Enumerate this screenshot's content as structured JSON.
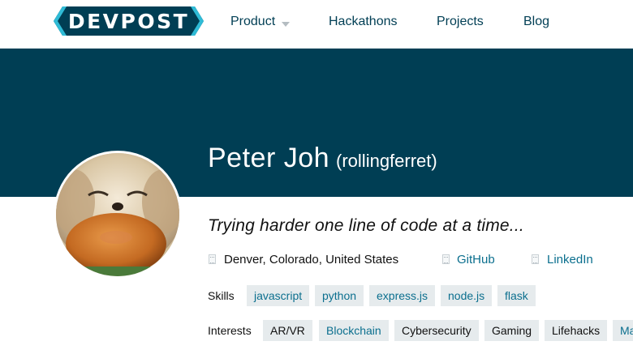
{
  "nav": {
    "logo_text": "DEVPOST",
    "items": [
      {
        "label": "Product"
      },
      {
        "label": "Hackathons"
      },
      {
        "label": "Projects"
      },
      {
        "label": "Blog"
      }
    ]
  },
  "profile": {
    "name": "Peter Joh",
    "username": "(rollingferret)",
    "tagline": "Trying harder one line of code at a time...",
    "location": "Denver, Colorado, United States",
    "links": [
      {
        "label": "GitHub",
        "icon": "link-icon"
      },
      {
        "label": "LinkedIn",
        "icon": "link-icon"
      }
    ]
  },
  "skills": {
    "label": "Skills",
    "tags": [
      "javascript",
      "python",
      "express.js",
      "node.js",
      "flask"
    ]
  },
  "interests": {
    "label": "Interests",
    "tags": [
      "AR/VR",
      "Blockchain",
      "Cybersecurity",
      "Gaming",
      "Lifehacks",
      "Ma"
    ]
  },
  "colors": {
    "brand": "#003e54",
    "link": "#0b6f8e",
    "logo_accent": "#2fbbd6",
    "tag_background": "#e6ebed"
  }
}
